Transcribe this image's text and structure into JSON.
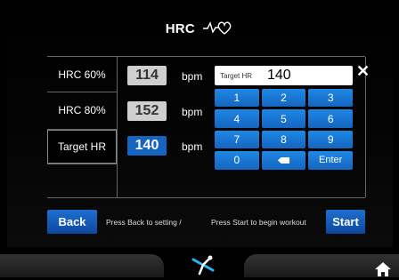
{
  "header": {
    "title": "HRC"
  },
  "rows": [
    {
      "label": "HRC 60%",
      "value": "114",
      "unit": "bpm"
    },
    {
      "label": "HRC 80%",
      "value": "152",
      "unit": "bpm"
    },
    {
      "label": "Target  HR",
      "value": "140",
      "unit": "bpm"
    }
  ],
  "input": {
    "label": "Target  HR",
    "value": "140"
  },
  "keypad": {
    "keys": [
      "1",
      "2",
      "3",
      "4",
      "5",
      "6",
      "7",
      "8",
      "9",
      "0"
    ],
    "enter": "Enter"
  },
  "footer": {
    "back": "Back",
    "hint_back": "Press Back to setting /",
    "hint_start": "Press Start to begin workout",
    "start": "Start"
  },
  "colors": {
    "accent": "#1565c0",
    "grey_value": "#cfcfcf"
  },
  "icons": {
    "heart": "heart-pulse-icon",
    "close": "close-icon",
    "backspace": "backspace-icon",
    "center": "fitness-logo-icon",
    "home": "home-icon"
  }
}
